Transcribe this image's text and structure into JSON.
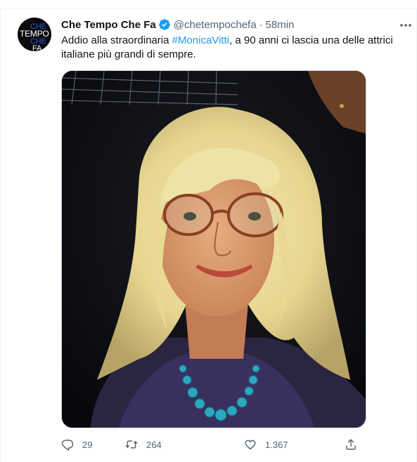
{
  "tweet": {
    "author_name": "Che Tempo Che Fa",
    "handle": "@chetempochefa",
    "separator": "·",
    "time": "58min",
    "text_before": "Addio alla straordinaria ",
    "hashtag": "#MonicaVitti",
    "text_after": ", a 90 anni ci lascia una delle attrici italiane più grandi di sempre.",
    "avatar_text": [
      "CHE",
      "TEMPO",
      "CHE",
      "FA"
    ]
  },
  "actions": {
    "reply_count": "29",
    "retweet_count": "264",
    "like_count": "1.367"
  },
  "icons": {
    "verified": "verified-badge-icon",
    "more": "more-dots-icon",
    "reply": "reply-icon",
    "retweet": "retweet-icon",
    "like": "heart-icon",
    "share": "share-icon"
  },
  "colors": {
    "accent": "#1d9bf0",
    "text": "#0f1419",
    "secondary": "#536471"
  }
}
